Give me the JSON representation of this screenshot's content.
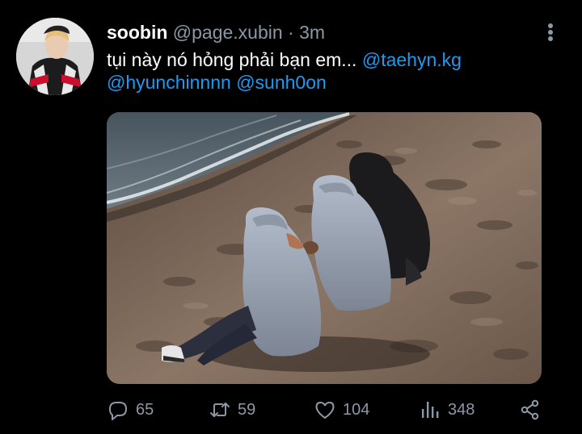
{
  "tweet": {
    "author": {
      "display_name": "soobin",
      "handle": "@page.xubin",
      "separator": "·",
      "time": "3m",
      "avatar_icon": "avatar"
    },
    "text": {
      "body": "tụi này nó hỏng phải bạn em...",
      "mentions": [
        "@taehyn.kg",
        "@hyunchinnnn",
        "@sunh0on"
      ]
    },
    "media": {
      "type": "photo",
      "scene": "three people in hoodies sitting on a sandy beach by the sea"
    },
    "stats": {
      "replies": "65",
      "retweets": "59",
      "likes": "104",
      "views": "348"
    },
    "icons": {
      "more": "more-vertical-icon",
      "reply": "reply-icon",
      "retweet": "retweet-icon",
      "like": "heart-icon",
      "views": "views-icon",
      "share": "share-icon"
    }
  },
  "colors": {
    "background": "#000000",
    "text": "#ffffff",
    "muted": "#8b98a5",
    "accent": "#1d9bf0"
  }
}
